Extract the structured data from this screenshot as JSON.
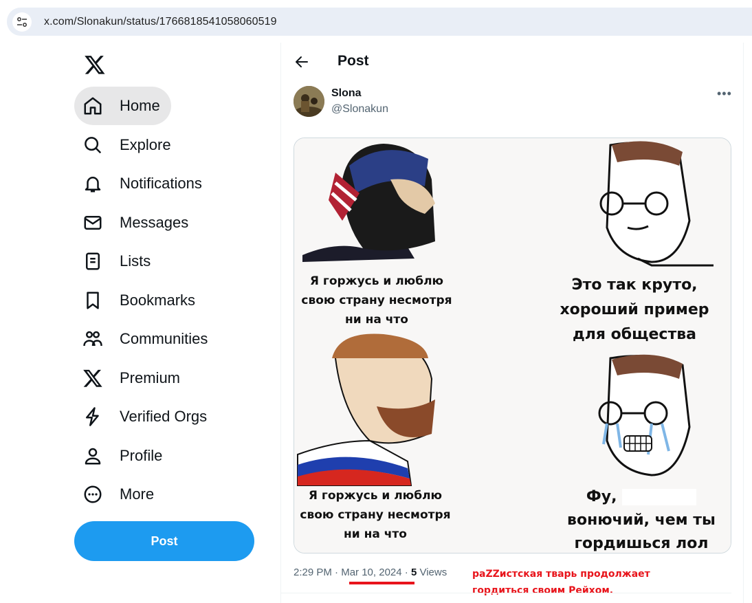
{
  "browser": {
    "url": "x.com/Slonakun/status/1766818541058060519"
  },
  "nav": {
    "items": [
      {
        "label": "Home",
        "icon": "home-icon"
      },
      {
        "label": "Explore",
        "icon": "search-icon"
      },
      {
        "label": "Notifications",
        "icon": "bell-icon"
      },
      {
        "label": "Messages",
        "icon": "envelope-icon"
      },
      {
        "label": "Lists",
        "icon": "list-icon"
      },
      {
        "label": "Bookmarks",
        "icon": "bookmark-icon"
      },
      {
        "label": "Communities",
        "icon": "people-icon"
      },
      {
        "label": "Premium",
        "icon": "x-logo-icon"
      },
      {
        "label": "Verified Orgs",
        "icon": "lightning-icon"
      },
      {
        "label": "Profile",
        "icon": "person-icon"
      },
      {
        "label": "More",
        "icon": "more-circle-icon"
      }
    ],
    "post_button": "Post"
  },
  "header": {
    "title": "Post"
  },
  "tweet": {
    "author_name": "Slona",
    "author_handle": "@Slonakun",
    "meme": {
      "panel1": "Я горжусь и люблю свою страну несмотря ни на что",
      "panel2": "Это так круто, хороший пример для общества",
      "panel3": "Я горжусь и люблю свою страну несмотря ни на что",
      "panel4_prefix": "Фу,",
      "panel4_rest": "вонючий, чем ты гордишься лол"
    },
    "time": "2:29 PM",
    "sep1": "·",
    "date": "Mar 10, 2024",
    "sep2": "·",
    "views_count": "5",
    "views_label": "Views"
  },
  "annotation": {
    "line1": "paZZистская тварь продолжает",
    "line2": "гордиться своим Рейхом."
  },
  "colors": {
    "accent": "#1d9bf0",
    "annotation": "#e8141b"
  }
}
